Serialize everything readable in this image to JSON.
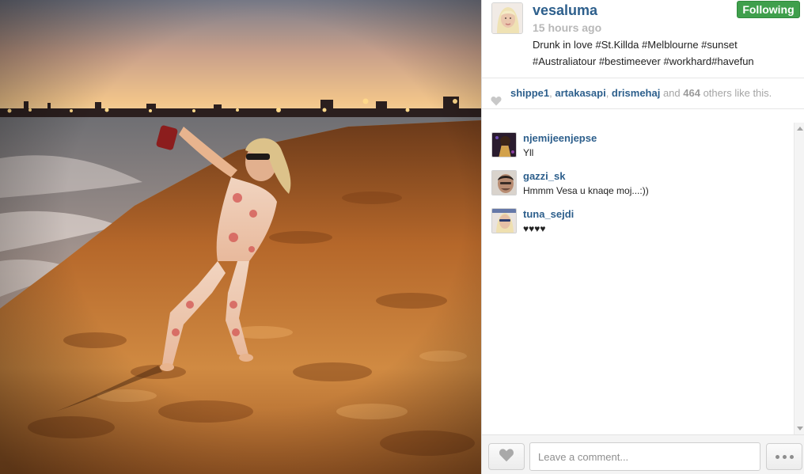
{
  "post": {
    "username": "vesaluma",
    "time_ago": "15 hours ago",
    "follow_label": "Following",
    "caption_line1": "Drunk in love #St.Killda #Melblourne #sunset",
    "caption_line2": "#Australiatour #bestimeever #workhard#havefun"
  },
  "likes": {
    "users": [
      "shippe1",
      "artakasapi",
      "drismehaj"
    ],
    "sep": ", ",
    "and_text": " and ",
    "count": "464",
    "suffix": " others like this."
  },
  "comments": [
    {
      "user": "njemijeenjepse",
      "text": "Yll"
    },
    {
      "user": "gazzi_sk",
      "text": "Hmmm Vesa u knaqe moj...:))"
    },
    {
      "user": "tuna_sejdi",
      "text": "♥♥♥♥"
    }
  ],
  "footer": {
    "comment_placeholder": "Leave a comment..."
  },
  "colors": {
    "link_blue": "#2d5f8c",
    "following_green": "#3f9f4c"
  },
  "icons": {
    "like": "heart-icon",
    "more": "ellipsis-icon"
  }
}
